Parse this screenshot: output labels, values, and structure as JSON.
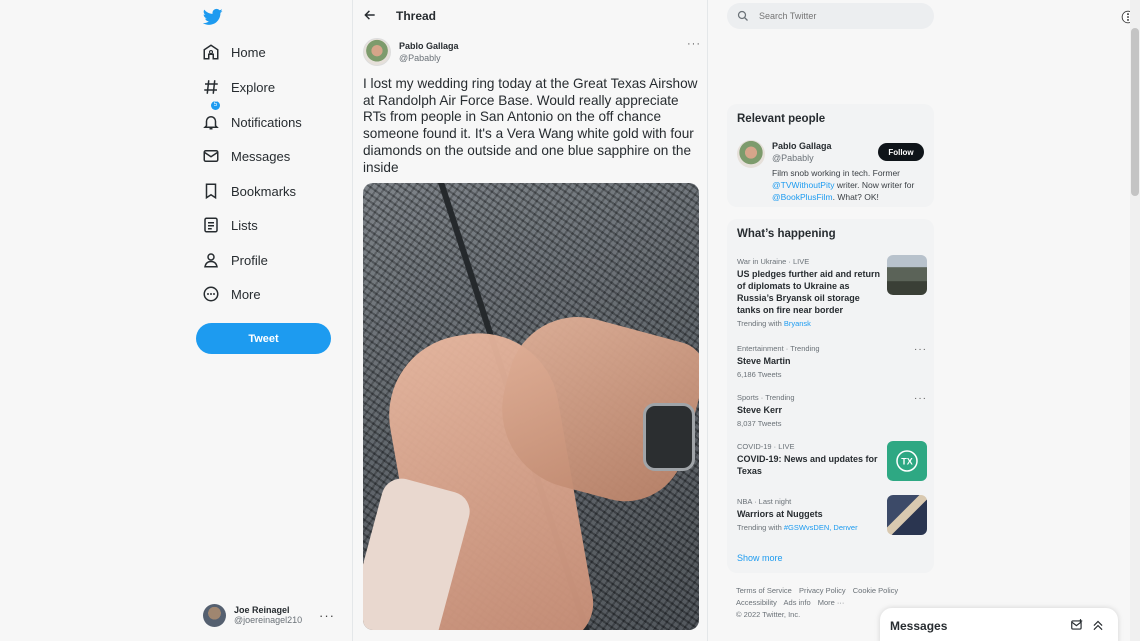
{
  "nav": {
    "items": [
      {
        "label": "Home",
        "icon": "home-icon"
      },
      {
        "label": "Explore",
        "icon": "hashtag-icon"
      },
      {
        "label": "Notifications",
        "icon": "bell-icon",
        "badge": "5"
      },
      {
        "label": "Messages",
        "icon": "envelope-icon"
      },
      {
        "label": "Bookmarks",
        "icon": "bookmark-icon"
      },
      {
        "label": "Lists",
        "icon": "list-icon"
      },
      {
        "label": "Profile",
        "icon": "person-icon"
      },
      {
        "label": "More",
        "icon": "more-circle-icon"
      }
    ],
    "tweet_button": "Tweet",
    "user": {
      "name": "Joe Reinagel",
      "handle": "@joereinagel210"
    }
  },
  "thread": {
    "title": "Thread",
    "author": {
      "name": "Pablo Gallaga",
      "handle": "@Pabably"
    },
    "text": "I lost my wedding ring today at the Great Texas Airshow at Randolph Air Force Base. Would really appreciate RTs from people in San Antonio on the off chance someone found it. It's a Vera Wang white gold with four diamonds on the outside and one blue sapphire on the inside"
  },
  "search": {
    "placeholder": "Search Twitter"
  },
  "relevant_people": {
    "title": "Relevant people",
    "name": "Pablo Gallaga",
    "handle": "@Pabably",
    "follow_label": "Follow",
    "bio_1": "Film snob working in tech. Former ",
    "bio_link_1": "@TVWithoutPity",
    "bio_2": " writer. Now writer for ",
    "bio_link_2": "@BookPlusFilm",
    "bio_3": ". What? OK!"
  },
  "happening": {
    "title": "What’s happening",
    "trends": [
      {
        "meta": "War in Ukraine · LIVE",
        "title": "US pledges further aid and return of diplomats to Ukraine as Russia’s Bryansk oil storage tanks on fire near border",
        "sub_prefix": "Trending with ",
        "sub_link": "Bryansk"
      },
      {
        "meta": "Entertainment · Trending",
        "title": "Steve Martin",
        "sub": "6,186 Tweets"
      },
      {
        "meta": "Sports · Trending",
        "title": "Steve Kerr",
        "sub": "8,037 Tweets"
      },
      {
        "meta": "COVID-19 · LIVE",
        "title": "COVID-19: News and updates for Texas"
      },
      {
        "meta": "NBA · Last night",
        "title": "Warriors at Nuggets",
        "sub_prefix": "Trending with ",
        "sub_link": "#GSWvsDEN, Denver"
      }
    ],
    "show_more": "Show more"
  },
  "footer": {
    "links_row1": [
      "Terms of Service",
      "Privacy Policy",
      "Cookie Policy"
    ],
    "links_row2": [
      "Accessibility",
      "Ads info",
      "More ···"
    ],
    "copyright": "© 2022 Twitter, Inc."
  },
  "messages": {
    "title": "Messages"
  },
  "colors": {
    "accent": "#1d9bf0",
    "text": "#0f1419",
    "background": "#f7f7f7"
  }
}
